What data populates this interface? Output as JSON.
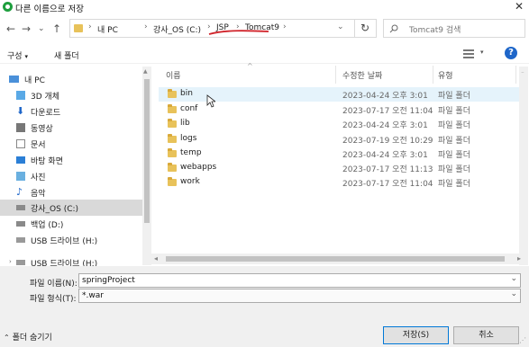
{
  "title": "다른 이름으로 저장",
  "address": {
    "crumbs": [
      "내 PC",
      "강사_OS (C:)",
      "JSP",
      "Tomcat9"
    ],
    "search_placeholder": "Tomcat9 검색"
  },
  "toolbar": {
    "organize": "구성",
    "new_folder": "새 폴더"
  },
  "columns": {
    "name": "이름",
    "modified": "수정한 날짜",
    "type": "유형"
  },
  "sidebar": {
    "items": [
      {
        "label": "내 PC",
        "icon": "pc-icon"
      },
      {
        "label": "3D 개체",
        "icon": "cube-icon"
      },
      {
        "label": "다운로드",
        "icon": "download-icon"
      },
      {
        "label": "동영상",
        "icon": "video-icon"
      },
      {
        "label": "문서",
        "icon": "document-icon"
      },
      {
        "label": "바탕 화면",
        "icon": "desktop-icon"
      },
      {
        "label": "사진",
        "icon": "picture-icon"
      },
      {
        "label": "음악",
        "icon": "music-icon"
      },
      {
        "label": "강사_OS (C:)",
        "icon": "drive-icon"
      },
      {
        "label": "백업 (D:)",
        "icon": "drive-icon"
      },
      {
        "label": "USB 드라이브 (H:)",
        "icon": "usb-icon"
      },
      {
        "label": "USB 드라이브 (H:)",
        "icon": "usb-icon"
      }
    ]
  },
  "files": [
    {
      "name": "bin",
      "date": "2023-04-24 오후 3:01",
      "type": "파일 폴더"
    },
    {
      "name": "conf",
      "date": "2023-07-17 오전 11:04",
      "type": "파일 폴더"
    },
    {
      "name": "lib",
      "date": "2023-04-24 오후 3:01",
      "type": "파일 폴더"
    },
    {
      "name": "logs",
      "date": "2023-07-19 오전 10:29",
      "type": "파일 폴더"
    },
    {
      "name": "temp",
      "date": "2023-04-24 오후 3:01",
      "type": "파일 폴더"
    },
    {
      "name": "webapps",
      "date": "2023-07-17 오전 11:13",
      "type": "파일 폴더"
    },
    {
      "name": "work",
      "date": "2023-07-17 오전 11:04",
      "type": "파일 폴더"
    }
  ],
  "save": {
    "filename_label": "파일 이름(N):",
    "filename_value": "springProject",
    "filetype_label": "파일 형식(T):",
    "filetype_value": "*.war"
  },
  "footer": {
    "hide_folders": "폴더 숨기기",
    "save_button": "저장(S)",
    "cancel_button": "취소"
  },
  "colors": {
    "folder": "#e8c25a",
    "selection": "#d9d9d9",
    "hover": "#e5f3fb",
    "accent": "#0078d7"
  }
}
